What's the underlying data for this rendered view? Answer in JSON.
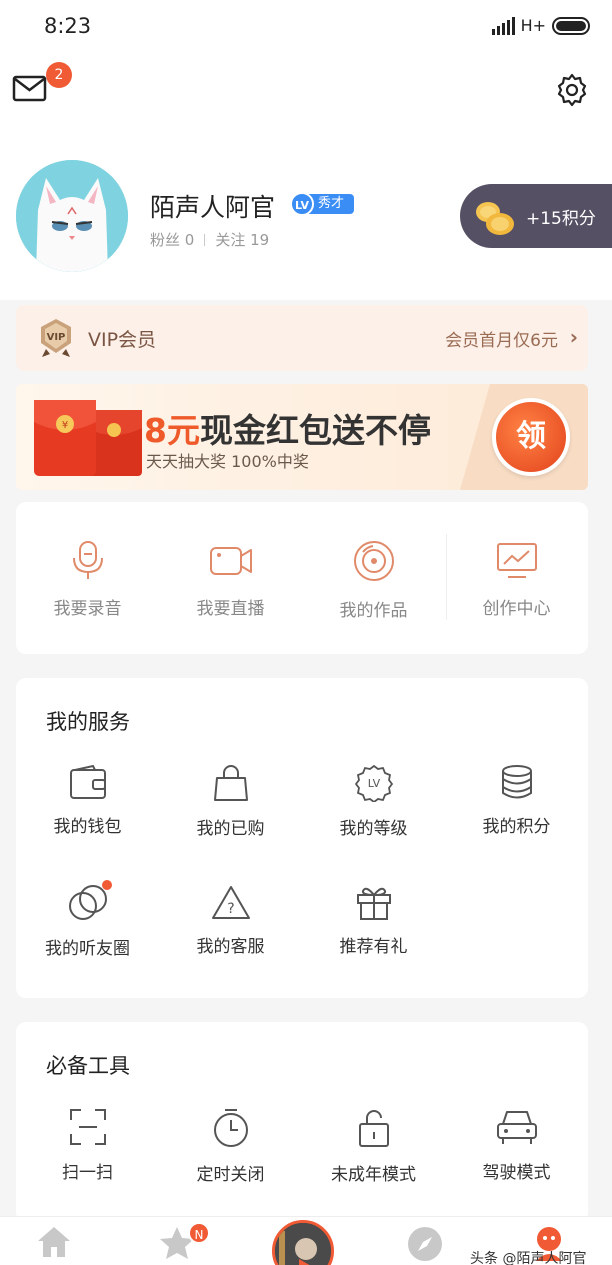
{
  "status_bar": {
    "time": "8:23",
    "network": "H+"
  },
  "header": {
    "mail_badge": "2"
  },
  "profile": {
    "username": "陌声人阿官",
    "level_badge": "LV",
    "level_title": "秀才",
    "fans_label": "粉丝",
    "fans_count": "0",
    "follow_label": "关注",
    "follow_count": "19",
    "points_bonus": "+15积分"
  },
  "vip": {
    "label": "VIP会员",
    "offer": "会员首月仅6元",
    "chevron": "›"
  },
  "promo": {
    "highlight": "8元",
    "title": "现金红包送不停",
    "subtitle": "天天抽大奖 100%中奖",
    "button": "领"
  },
  "create": [
    {
      "label": "我要录音",
      "icon": "mic-icon"
    },
    {
      "label": "我要直播",
      "icon": "video-camera-icon"
    },
    {
      "label": "我的作品",
      "icon": "disc-icon"
    },
    {
      "label": "创作中心",
      "icon": "monitor-chart-icon"
    }
  ],
  "services": {
    "title": "我的服务",
    "items": [
      {
        "label": "我的钱包",
        "icon": "wallet-icon"
      },
      {
        "label": "我的已购",
        "icon": "shopping-bag-icon"
      },
      {
        "label": "我的等级",
        "icon": "level-badge-icon"
      },
      {
        "label": "我的积分",
        "icon": "coin-stack-icon"
      },
      {
        "label": "我的听友圈",
        "icon": "circles-icon"
      },
      {
        "label": "我的客服",
        "icon": "help-triangle-icon"
      },
      {
        "label": "推荐有礼",
        "icon": "gift-icon"
      }
    ]
  },
  "tools": {
    "title": "必备工具",
    "items": [
      {
        "label": "扫一扫",
        "icon": "scan-icon"
      },
      {
        "label": "定时关闭",
        "icon": "timer-icon"
      },
      {
        "label": "未成年模式",
        "icon": "unlock-icon"
      },
      {
        "label": "驾驶模式",
        "icon": "car-icon"
      }
    ]
  },
  "bottom_nav": {
    "subscribe_badge": "N",
    "watermark": "头条 @陌声人阿官"
  },
  "colors": {
    "accent": "#f05a34",
    "vip_text": "#7a5543",
    "level_blue": "#3a8df5"
  }
}
